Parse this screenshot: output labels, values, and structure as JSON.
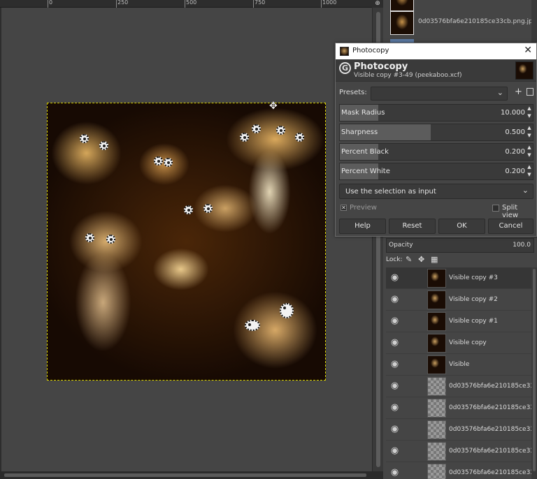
{
  "ruler": {
    "labels": [
      "0",
      "250",
      "500",
      "750",
      "1000"
    ]
  },
  "images_panel": {
    "items": [
      {
        "name": "0d03576bfa6e210185ce33cb.png.jpg"
      }
    ]
  },
  "layers_panel": {
    "opacity_label": "Opacity",
    "opacity_value": "100.0",
    "lock_label": "Lock:",
    "layers": [
      {
        "name": "Visible copy #3",
        "thumb": "photo",
        "active": true
      },
      {
        "name": "Visible copy #2",
        "thumb": "photo",
        "active": false
      },
      {
        "name": "Visible copy #1",
        "thumb": "photo",
        "active": false
      },
      {
        "name": "Visible copy",
        "thumb": "photo",
        "active": false
      },
      {
        "name": "Visible",
        "thumb": "photo",
        "active": false
      },
      {
        "name": "0d03576bfa6e210185ce33",
        "thumb": "check",
        "active": false
      },
      {
        "name": "0d03576bfa6e210185ce33",
        "thumb": "check",
        "active": false
      },
      {
        "name": "0d03576bfa6e210185ce33",
        "thumb": "check",
        "active": false
      },
      {
        "name": "0d03576bfa6e210185ce33",
        "thumb": "check",
        "active": false
      },
      {
        "name": "0d03576bfa6e210185ce33",
        "thumb": "check",
        "active": false
      }
    ]
  },
  "dialog": {
    "window_title": "Photocopy",
    "header_title": "Photocopy",
    "header_subtitle": "Visible copy #3-49 (peekaboo.xcf)",
    "presets_label": "Presets:",
    "presets_value": "",
    "sliders": [
      {
        "label": "Mask Radius",
        "value": "10.000",
        "fraction": 0.2
      },
      {
        "label": "Sharpness",
        "value": "0.500",
        "fraction": 0.47
      },
      {
        "label": "Percent Black",
        "value": "0.200",
        "fraction": 0.2
      },
      {
        "label": "Percent White",
        "value": "0.200",
        "fraction": 0.2
      }
    ],
    "input_mode": "Use the selection as input",
    "preview_label": "Preview",
    "preview_checked": true,
    "split_view_label": "Split view",
    "buttons": {
      "help": "Help",
      "reset": "Reset",
      "ok": "OK",
      "cancel": "Cancel"
    }
  },
  "colors": {
    "selection_border": "#d8d200",
    "dialog_bg": "#454545",
    "titlebar_bg": "#ffffff"
  }
}
